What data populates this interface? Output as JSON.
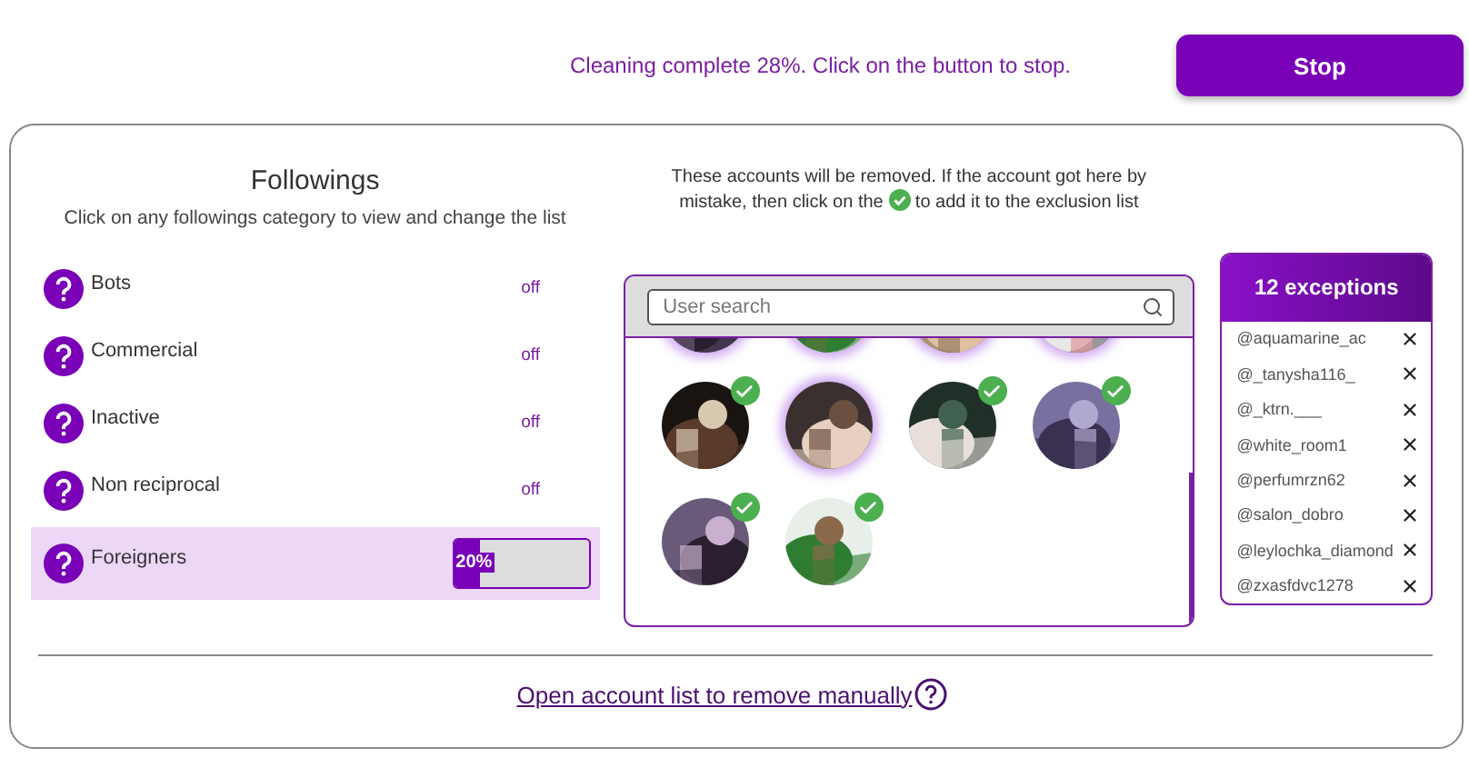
{
  "status_text": "Cleaning complete 28%. Click on the button to stop.",
  "stop_button": "Stop",
  "followings": {
    "title": "Followings",
    "subtitle": "Click on any followings category to view and change the list",
    "categories": [
      {
        "label": "Bots",
        "kind": "status",
        "status": "off",
        "selected": false
      },
      {
        "label": "Commercial",
        "kind": "status",
        "status": "off",
        "selected": false
      },
      {
        "label": "Inactive",
        "kind": "status",
        "status": "off",
        "selected": false
      },
      {
        "label": "Non reciprocal",
        "kind": "status",
        "status": "off",
        "selected": false
      },
      {
        "label": "Foreigners",
        "kind": "progress",
        "level": 0.2,
        "reading": "20%",
        "selected": true
      }
    ]
  },
  "removal": {
    "note_before": "These accounts will be removed. If the account got here by mistake, then click on the",
    "note_after": "to add it to the exclusion list",
    "search": {
      "placeholder": "User search"
    },
    "avatars": [
      {
        "checked": false
      },
      {
        "checked": false
      },
      {
        "checked": false
      },
      {
        "checked": false
      },
      {
        "checked": true
      },
      {
        "checked": false
      },
      {
        "checked": true
      },
      {
        "checked": true
      },
      {
        "checked": true
      },
      {
        "checked": true
      }
    ]
  },
  "exceptions": {
    "title": "12 exceptions",
    "items": [
      "@aquamarine_ac",
      "@_tanysha116_",
      "@_ktrn.___",
      "@white_room1",
      "@perfumrzn62",
      "@salon_dobro",
      "@leylochka_diamond",
      "@zxasfdvc1278"
    ]
  },
  "manual_link": "Open account list to remove manually"
}
